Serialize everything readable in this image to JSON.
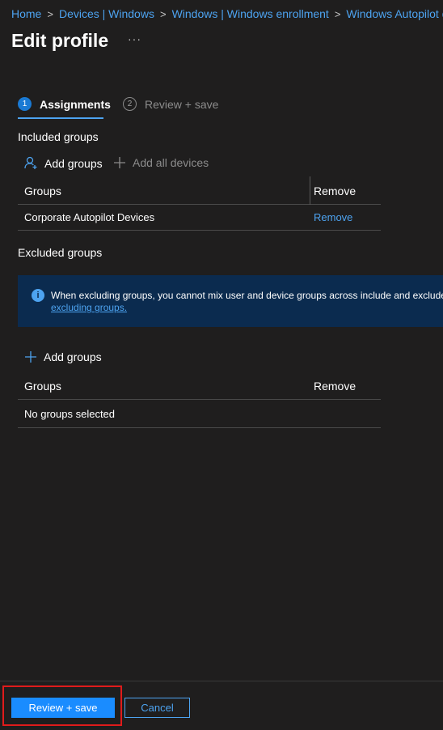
{
  "breadcrumb": [
    {
      "label": "Home"
    },
    {
      "label": "Devices | Windows"
    },
    {
      "label": "Windows | Windows enrollment"
    },
    {
      "label": "Windows Autopilot d"
    }
  ],
  "page": {
    "title": "Edit profile",
    "more": "···"
  },
  "tabs": [
    {
      "step": "1",
      "label": "Assignments",
      "active": true
    },
    {
      "step": "2",
      "label": "Review + save",
      "active": false
    }
  ],
  "included": {
    "label": "Included groups",
    "add_groups": "Add groups",
    "add_all_devices": "Add all devices",
    "columns": {
      "groups": "Groups",
      "remove": "Remove"
    },
    "rows": [
      {
        "group": "Corporate Autopilot Devices",
        "remove": "Remove"
      }
    ]
  },
  "excluded": {
    "label": "Excluded groups",
    "info_text": "When excluding groups, you cannot mix user and device groups across include and exclude",
    "info_link": "excluding groups.",
    "add_groups": "Add groups",
    "columns": {
      "groups": "Groups",
      "remove": "Remove"
    },
    "empty_text": "No groups selected"
  },
  "footer": {
    "primary": "Review + save",
    "secondary": "Cancel"
  },
  "colors": {
    "accent": "#4da3f0",
    "highlight": "#e01b1b",
    "info_bg": "#0b2b4f"
  }
}
